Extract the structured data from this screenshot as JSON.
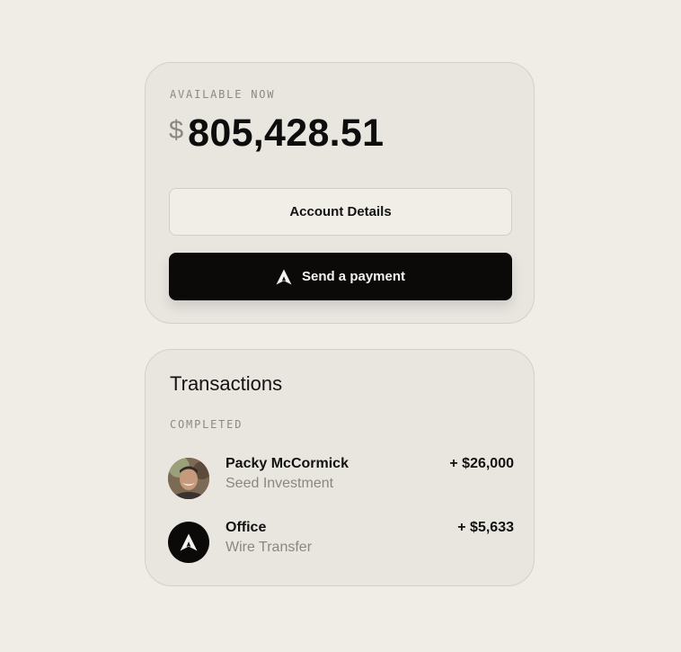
{
  "balance_card": {
    "label": "AVAILABLE NOW",
    "currency_symbol": "$",
    "amount": "805,428.51",
    "account_details_label": "Account Details",
    "send_payment_label": "Send a payment",
    "send_icon": "arrow-a-logo-icon"
  },
  "transactions": {
    "title": "Transactions",
    "section_label": "COMPLETED",
    "items": [
      {
        "name": "Packy McCormick",
        "subtitle": "Seed Investment",
        "amount": "+ $26,000",
        "avatar": "person-photo"
      },
      {
        "name": "Office",
        "subtitle": "Wire Transfer",
        "amount": "+ $5,633",
        "avatar": "arrow-a-logo-icon"
      }
    ]
  },
  "colors": {
    "background": "#f0ede7",
    "card": "#e9e6e0",
    "primary_button": "#0b0a09",
    "secondary_button": "#f1eee8",
    "muted_text": "#8a8781"
  }
}
